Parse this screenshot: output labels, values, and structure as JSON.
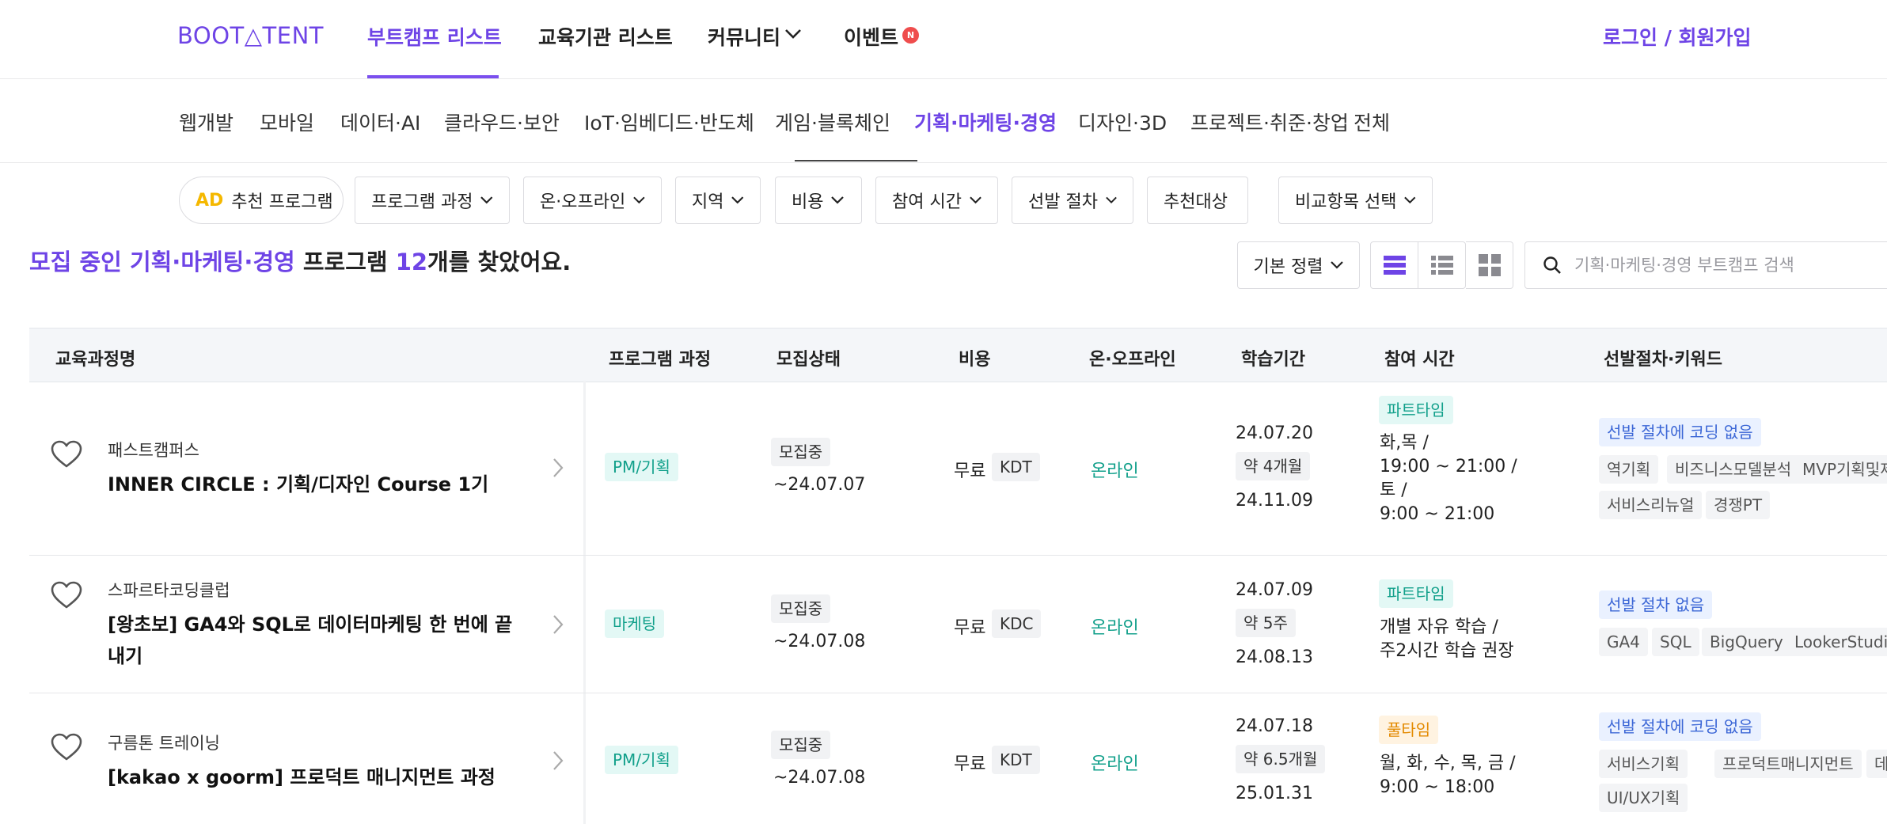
{
  "header": {
    "logo": "BOOT△TENT",
    "nav": [
      {
        "label": "부트캠프 리스트"
      },
      {
        "label": "교육기관 리스트"
      },
      {
        "label": "커뮤니티"
      },
      {
        "label": "이벤트"
      }
    ],
    "new_badge": "N",
    "login": "로그인 / 회원가입"
  },
  "categories": [
    "웹개발",
    "모바일",
    "데이터·AI",
    "클라우드·보안",
    "IoT·임베디드·반도체",
    "게임·블록체인",
    "기획·마케팅·경영",
    "디자인·3D",
    "프로젝트·취준·창업",
    "전체"
  ],
  "filters": {
    "ad_label": "AD",
    "ad_text": "추천 프로그램",
    "chips": [
      "프로그램 과정",
      "온·오프라인",
      "지역",
      "비용",
      "참여 시간",
      "선발 절차",
      "추천대상",
      "비교항목 선택"
    ]
  },
  "result": {
    "prefix": "모집 중인",
    "category": "기획·마케팅·경영",
    "middle": "프로그램",
    "count": "12",
    "suffix": "개를 찾았어요."
  },
  "sort_label": "기본 정렬",
  "search": {
    "placeholder": "기획·마케팅·경영 부트캠프 검색"
  },
  "table": {
    "columns": [
      "교육과정명",
      "프로그램 과정",
      "모집상태",
      "비용",
      "온·오프라인",
      "학습기간",
      "참여 시간",
      "선발절차·키워드"
    ],
    "rows": [
      {
        "org": "패스트캠퍼스",
        "title": "INNER CIRCLE : 기획/디자인 Course 1기",
        "program": "PM/기획",
        "status": "모집중",
        "deadline": "~24.07.07",
        "cost": "무료",
        "cost_type": "KDT",
        "mode": "온라인",
        "start": "24.07.20",
        "duration": "약 4개월",
        "end": "24.11.09",
        "time_type": "파트타임",
        "schedule": [
          "화,목 /",
          "19:00 ~ 21:00 /",
          "토 /",
          "9:00 ~ 21:00"
        ],
        "selection": "선발 절차에 코딩 없음",
        "keywords": [
          "역기획",
          "비즈니스모델분석",
          "MVP기획및제작",
          "서비스리뉴얼",
          "경쟁PT"
        ]
      },
      {
        "org": "스파르타코딩클럽",
        "title": "[왕초보] GA4와 SQL로 데이터마케팅 한 번에 끝내기",
        "program": "마케팅",
        "status": "모집중",
        "deadline": "~24.07.08",
        "cost": "무료",
        "cost_type": "KDC",
        "mode": "온라인",
        "start": "24.07.09",
        "duration": "약 5주",
        "end": "24.08.13",
        "time_type": "파트타임",
        "schedule": [
          "개별 자유 학습 /",
          "주2시간 학습 권장"
        ],
        "selection": "선발 절차 없음",
        "keywords": [
          "GA4",
          "SQL",
          "BigQuery",
          "LookerStudio"
        ]
      },
      {
        "org": "구름톤 트레이닝",
        "title": "[kakao x goorm] 프로덕트 매니지먼트 과정",
        "program": "PM/기획",
        "status": "모집중",
        "deadline": "~24.07.08",
        "cost": "무료",
        "cost_type": "KDT",
        "mode": "온라인",
        "start": "24.07.18",
        "duration": "약 6.5개월",
        "end": "25.01.31",
        "time_type": "풀타임",
        "schedule": [
          "월, 화, 수, 목, 금 /",
          "9:00 ~ 18:00"
        ],
        "selection": "선발 절차에 코딩 없음",
        "keywords": [
          "서비스기획",
          "프로덕트매니지먼트",
          "데이터분석",
          "UI/UX기획"
        ]
      }
    ]
  },
  "colors": {
    "accent": "#6e44e6",
    "mint_badge": "#12a08b",
    "fulltime_badge": "#e38a00",
    "selection_badge": "#3b66d6",
    "new_dot": "#ef4d4d"
  },
  "icons": [
    "heart-outline-icon",
    "chevron-right-icon",
    "chevron-down-icon",
    "search-icon",
    "list-view-icon",
    "detail-list-view-icon",
    "grid-view-icon"
  ]
}
